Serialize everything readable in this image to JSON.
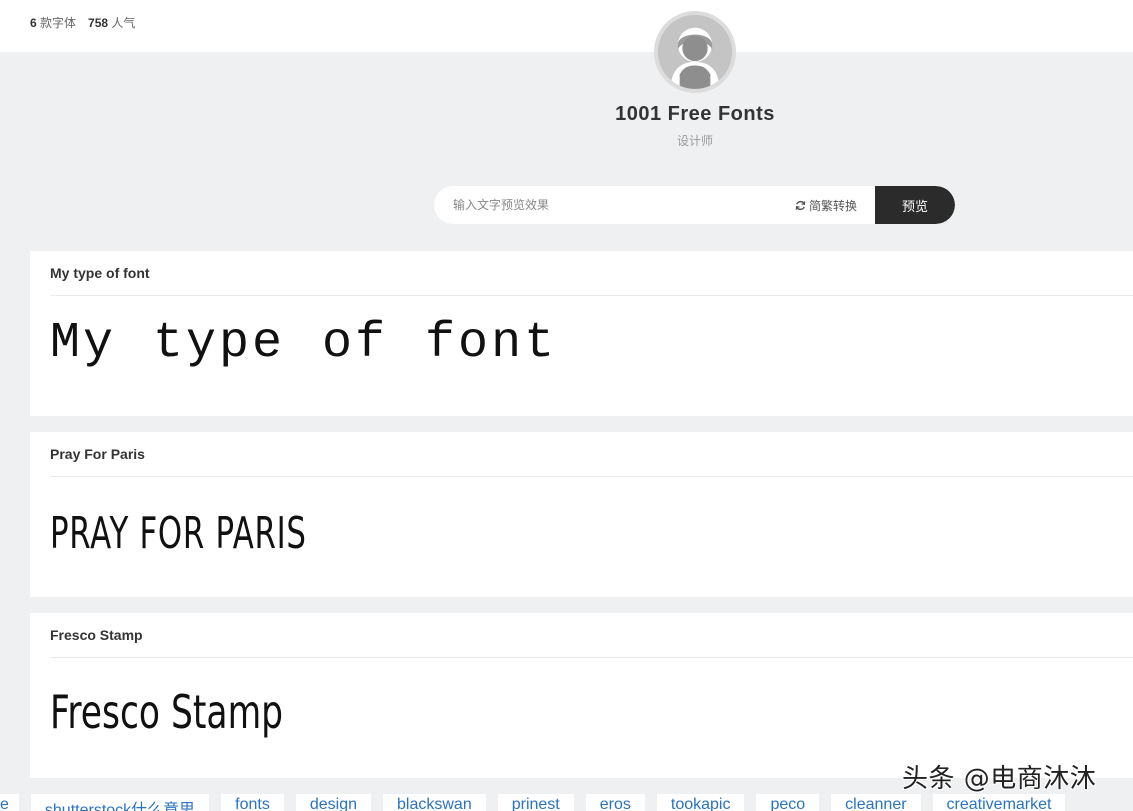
{
  "stats": {
    "font_count": "6",
    "font_count_label": "款字体",
    "popularity": "758",
    "popularity_label": "人气"
  },
  "designer": {
    "avatar_icon": "user-avatar-icon",
    "name": "1001 Free Fonts",
    "role": "设计师"
  },
  "search": {
    "placeholder": "输入文字预览效果",
    "value": "",
    "convert_label": "简繁转换",
    "convert_icon": "refresh-icon",
    "preview_button": "预览"
  },
  "fonts": [
    {
      "title": "My type of font",
      "preview": "My type of font"
    },
    {
      "title": "Pray For Paris",
      "preview": "PRAY FOR PARIS"
    },
    {
      "title": "Fresco Stamp",
      "preview": "Fresco Stamp"
    }
  ],
  "tags": [
    "e",
    "shutterstock什么意思",
    "fonts",
    "design",
    "blackswan",
    "prinest",
    "eros",
    "tookapic",
    "peco",
    "cleanner",
    "creativemarket"
  ],
  "watermark": "头条 @电商沐沐",
  "colors": {
    "page_bg": "#eef0f2",
    "button_dark": "#2b2b2b",
    "tag_link": "#2a73c2"
  }
}
